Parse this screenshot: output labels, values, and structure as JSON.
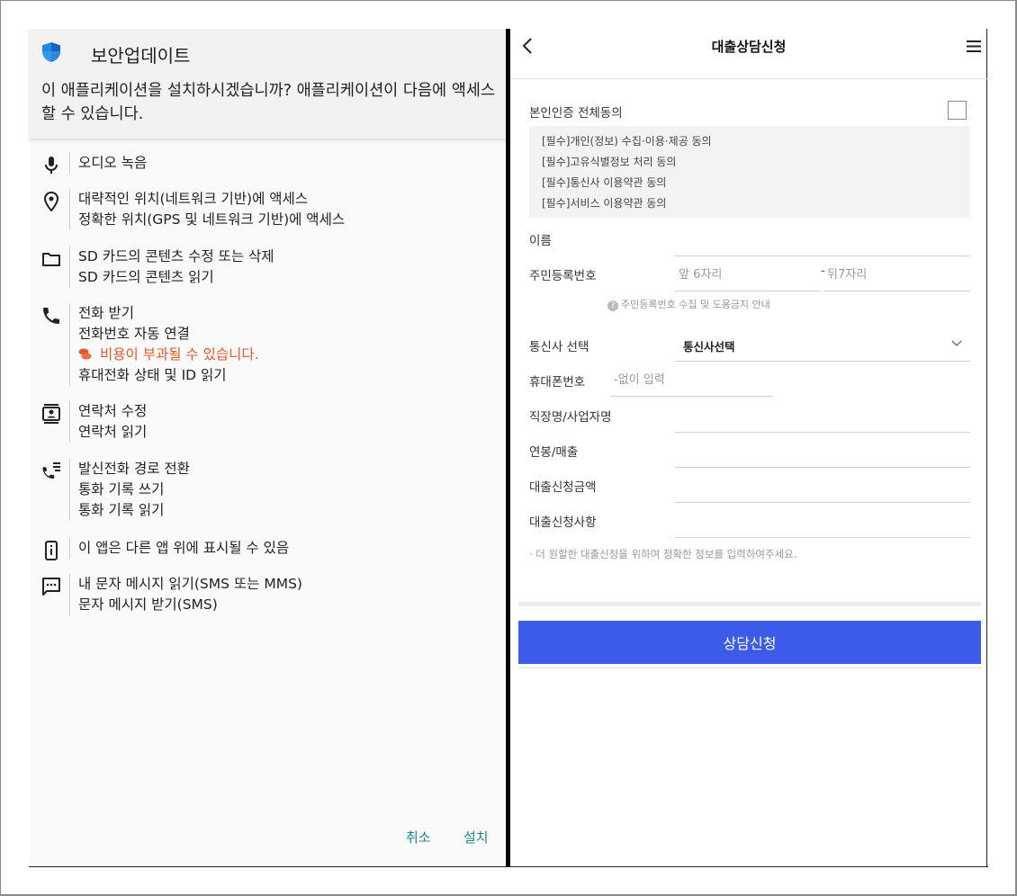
{
  "dialog": {
    "title": "보안업데이트",
    "question": "이 애플리케이션을 설치하시겠습니까? 애플리케이션이 다음에 액세스할 수 있습니다.",
    "permissions": [
      {
        "icon": "microphone-icon",
        "lines": [
          "오디오 녹음"
        ]
      },
      {
        "icon": "location-pin-icon",
        "lines": [
          "대략적인 위치(네트워크 기반)에 액세스",
          "정확한 위치(GPS 및 네트워크 기반)에 액세스"
        ]
      },
      {
        "icon": "folder-icon",
        "lines": [
          "SD 카드의 콘텐츠 수정 또는 삭제",
          "SD 카드의 콘텐츠 읽기"
        ]
      },
      {
        "icon": "phone-icon",
        "lines": [
          "전화 받기",
          "전화번호 자동 연결",
          "비용이 부과될 수 있습니다.",
          "휴대전화 상태 및 ID 읽기"
        ]
      },
      {
        "icon": "contact-card-icon",
        "lines": [
          "연락처 수정",
          "연락처 읽기"
        ]
      },
      {
        "icon": "call-forward-list-icon",
        "lines": [
          "발신전화 경로 전환",
          "통화 기록 쓰기",
          "통화 기록 읽기"
        ]
      },
      {
        "icon": "overlay-phone-icon",
        "lines": [
          "이 앱은 다른 앱 위에 표시될 수 있음"
        ]
      },
      {
        "icon": "message-icon",
        "lines": [
          "내 문자 메시지 읽기(SMS 또는 MMS)",
          "문자 메시지 받기(SMS)"
        ]
      }
    ],
    "cancel_label": "취소",
    "install_label": "설치"
  },
  "form": {
    "title": "대출상담신청",
    "agree_all_label": "본인인증 전체동의",
    "terms": [
      "[필수]개인(정보) 수집·이용·제공 동의",
      "[필수]고유식별정보 처리 동의",
      "[필수]통신사 이용약관 동의",
      "[필수]서비스 이용약관 동의"
    ],
    "name_label": "이름",
    "rrn_label": "주민등록번호",
    "rrn_front_placeholder": "앞 6자리",
    "rrn_dash": "-",
    "rrn_back_placeholder": "뒤7자리",
    "rrn_notice": "주민등록번호 수집 및 도용금지 안내",
    "carrier_label": "통신사 선택",
    "carrier_value": "통신사선택",
    "phone_label": "휴대폰번호",
    "phone_placeholder": "-없이 입력",
    "company_label": "직장명/사업자명",
    "income_label": "연봉/매출",
    "amount_label": "대출신청금액",
    "details_label": "대출신청사항",
    "hint": "· 더 원할한 대출신청을 위하여 정확한 정보를 입력하여주세요.",
    "submit_label": "상담신청"
  },
  "colors": {
    "warning": "#e8562b",
    "dialog_button": "#1a8a86",
    "submit": "#3b5be8",
    "shield": "#1e88e5"
  }
}
